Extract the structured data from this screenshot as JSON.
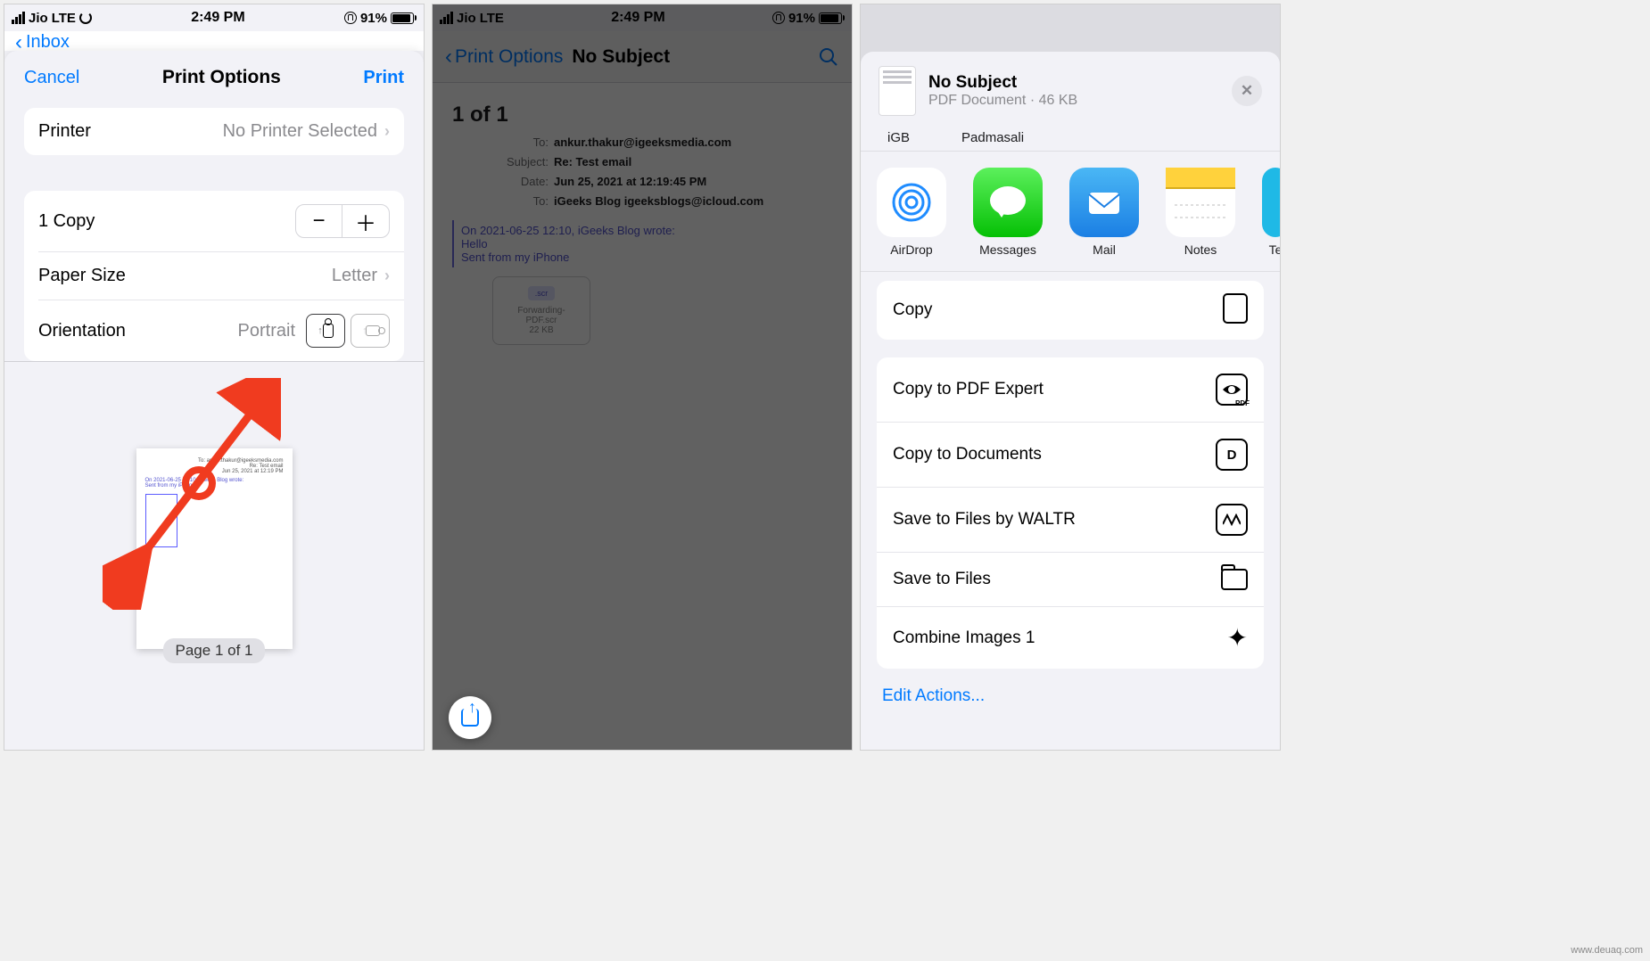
{
  "status": {
    "carrier": "Jio",
    "network": "LTE",
    "time": "2:49 PM",
    "battery": "91%"
  },
  "screen1": {
    "peek_back": "Inbox",
    "cancel": "Cancel",
    "title": "Print Options",
    "print": "Print",
    "printer_label": "Printer",
    "printer_value": "No Printer Selected",
    "copies": "1 Copy",
    "paper_label": "Paper Size",
    "paper_value": "Letter",
    "orientation_label": "Orientation",
    "orientation_value": "Portrait",
    "page_badge": "Page 1 of 1"
  },
  "screen2": {
    "back": "Print Options",
    "title": "No Subject",
    "page_count": "1 of 1",
    "to_label": "To:",
    "to_value": "ankur.thakur@igeeksmedia.com",
    "subject_label": "Subject:",
    "subject_value": "Re: Test email",
    "date_label": "Date:",
    "date_value": "Jun 25, 2021 at 12:19:45 PM",
    "tocc_label": "To:",
    "tocc_value": "iGeeks Blog igeeksblogs@icloud.com",
    "reply1": "On 2021-06-25 12:10, iGeeks Blog wrote:",
    "reply2": "Hello",
    "reply3": "Sent from my iPhone",
    "attach_name": "Forwarding-PDF.scr",
    "attach_size": "22 KB"
  },
  "screen3": {
    "doc_title": "No Subject",
    "doc_sub": "PDF Document · 46 KB",
    "contacts": [
      "iGB",
      "Padmasali"
    ],
    "share_targets": [
      "AirDrop",
      "Messages",
      "Mail",
      "Notes",
      "Te"
    ],
    "actions_single": "Copy",
    "actions": [
      "Copy to PDF Expert",
      "Copy to Documents",
      "Save to Files by WALTR",
      "Save to Files",
      "Combine Images 1"
    ],
    "edit": "Edit Actions..."
  }
}
